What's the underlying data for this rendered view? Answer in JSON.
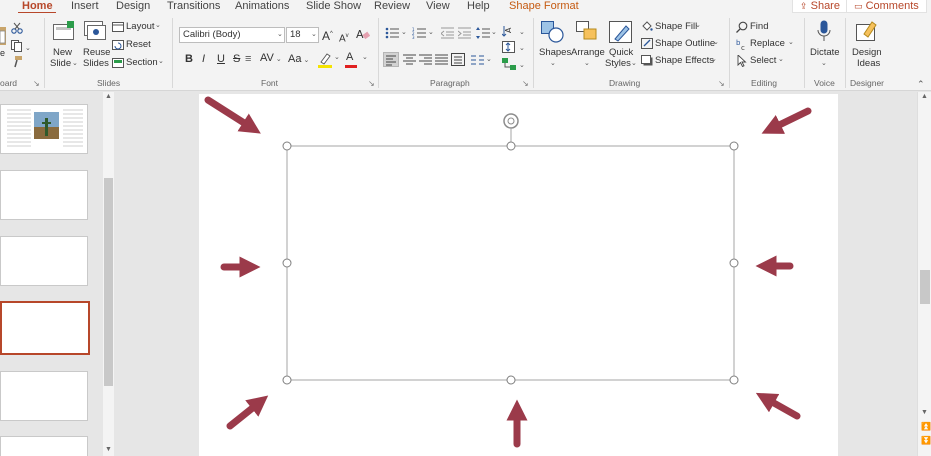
{
  "tabs": {
    "items": [
      "Home",
      "Insert",
      "Design",
      "Transitions",
      "Animations",
      "Slide Show",
      "Review",
      "View",
      "Help",
      "Shape Format"
    ],
    "share": "Share",
    "comments": "Comments"
  },
  "ribbon": {
    "clipboard": {
      "group_label": "oard"
    },
    "slides": {
      "new_slide": [
        "New",
        "Slide"
      ],
      "reuse_slides": [
        "Reuse",
        "Slides"
      ],
      "layout": "Layout",
      "reset": "Reset",
      "section": "Section",
      "group_label": "Slides"
    },
    "font": {
      "font_name": "Calibri (Body)",
      "font_size": "18",
      "bold": "B",
      "italic": "I",
      "underline": "U",
      "strike": "S",
      "spacing": "AV",
      "change_case": "Aa",
      "grow": "A",
      "shrink": "A",
      "font_color_glyph": "A",
      "group_label": "Font"
    },
    "paragraph": {
      "group_label": "Paragraph"
    },
    "drawing": {
      "shapes": "Shapes",
      "arrange": "Arrange",
      "quick_styles": [
        "Quick",
        "Styles"
      ],
      "shape_fill": "Shape Fill",
      "shape_outline": "Shape Outline",
      "shape_effects": "Shape Effects",
      "group_label": "Drawing"
    },
    "editing": {
      "find": "Find",
      "replace": "Replace",
      "select": "Select",
      "group_label": "Editing"
    },
    "voice": {
      "dictate": "Dictate",
      "group_label": "Voice"
    },
    "designer": {
      "design_ideas": [
        "Design",
        "Ideas"
      ],
      "group_label": "Designer"
    }
  },
  "colors": {
    "accent": "#b7472a",
    "shape_format_tab": "#c55a11",
    "arrow": "#9b3a4a",
    "handle": "#7f7f7f"
  }
}
